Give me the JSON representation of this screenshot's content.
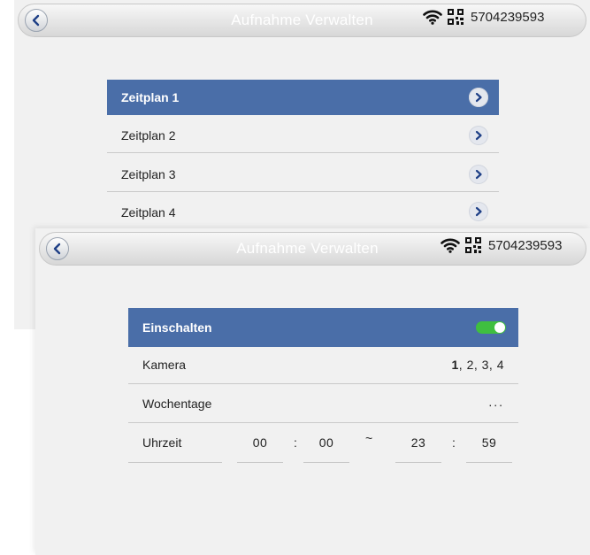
{
  "header": {
    "title": "Aufnahme Verwalten",
    "device_id": "5704239593"
  },
  "schedules": {
    "items": [
      {
        "label": "Zeitplan 1",
        "selected": true
      },
      {
        "label": "Zeitplan 2",
        "selected": false
      },
      {
        "label": "Zeitplan 3",
        "selected": false
      },
      {
        "label": "Zeitplan 4",
        "selected": false
      }
    ]
  },
  "settings": {
    "enable_label": "Einschalten",
    "enabled": true,
    "camera_label": "Kamera",
    "camera_value_first": "1",
    "camera_value_rest": ", 2, 3, 4",
    "weekdays_label": "Wochentage",
    "weekdays_value": "...",
    "time_label": "Uhrzeit",
    "start_hour": "00",
    "start_minute": "00",
    "range_separator": "~",
    "end_hour": "23",
    "end_minute": "59",
    "colon": ":"
  },
  "colors": {
    "accent": "#4a6ea8",
    "toggle_on": "#3fbf3f",
    "bar_background": "#e6e6e6"
  },
  "icons": [
    "back-arrow-icon",
    "wifi-icon",
    "qr-code-icon",
    "chevron-right-icon",
    "toggle-switch"
  ]
}
